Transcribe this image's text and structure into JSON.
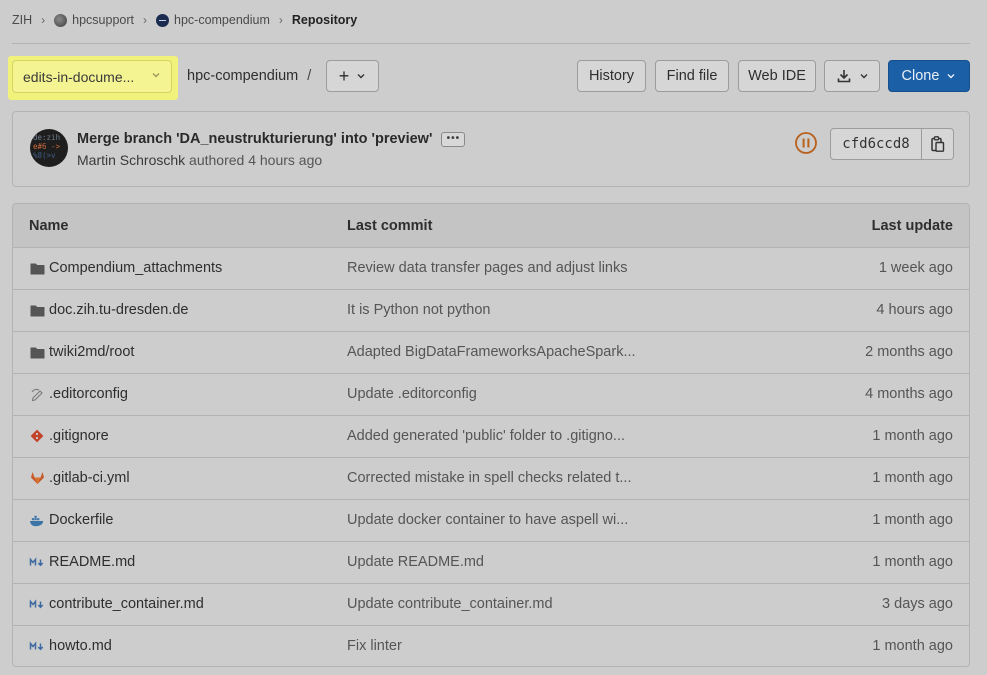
{
  "breadcrumb": {
    "items": [
      {
        "label": "ZIH",
        "icon": ""
      },
      {
        "label": "hpcsupport",
        "icon": "group-avatar-icon"
      },
      {
        "label": "hpc-compendium",
        "icon": "project-avatar-icon"
      },
      {
        "label": "Repository",
        "icon": ""
      }
    ]
  },
  "toolbar": {
    "branch": "edits-in-docume...",
    "repo_name": "hpc-compendium",
    "path_separator": "/",
    "add_label": "+",
    "history_label": "History",
    "find_file_label": "Find file",
    "web_ide_label": "Web IDE",
    "clone_label": "Clone"
  },
  "commit": {
    "title": "Merge branch 'DA_neustrukturierung' into 'preview'",
    "author": "Martin Schroschk",
    "action": "authored",
    "time": "4 hours ago",
    "sha": "cfd6ccd8",
    "avatar_text": [
      "de:zih",
      "e#6 ->",
      "%8(>v"
    ]
  },
  "table": {
    "headers": {
      "name": "Name",
      "last_commit": "Last commit",
      "last_update": "Last update"
    },
    "rows": [
      {
        "name": "Compendium_attachments",
        "icon": "folder-icon",
        "commit": "Review data transfer pages and adjust links",
        "date": "1 week ago"
      },
      {
        "name": "doc.zih.tu-dresden.de",
        "icon": "folder-icon",
        "commit": "It is Python not python",
        "date": "4 hours ago"
      },
      {
        "name": "twiki2md/root",
        "icon": "folder-icon",
        "commit": "Adapted BigDataFrameworksApacheSpark...",
        "date": "2 months ago"
      },
      {
        "name": ".editorconfig",
        "icon": "editorconfig-icon",
        "commit": "Update .editorconfig",
        "date": "4 months ago"
      },
      {
        "name": ".gitignore",
        "icon": "git-icon",
        "commit": "Added generated 'public' folder to .gitigno...",
        "date": "1 month ago"
      },
      {
        "name": ".gitlab-ci.yml",
        "icon": "gitlab-icon",
        "commit": "Corrected mistake in spell checks related t...",
        "date": "1 month ago"
      },
      {
        "name": "Dockerfile",
        "icon": "docker-icon",
        "commit": "Update docker container to have aspell wi...",
        "date": "1 month ago"
      },
      {
        "name": "README.md",
        "icon": "markdown-icon",
        "commit": "Update README.md",
        "date": "1 month ago"
      },
      {
        "name": "contribute_container.md",
        "icon": "markdown-icon",
        "commit": "Update contribute_container.md",
        "date": "3 days ago"
      },
      {
        "name": "howto.md",
        "icon": "markdown-icon",
        "commit": "Fix linter",
        "date": "1 month ago"
      }
    ]
  },
  "colors": {
    "background": "#cdcdcd",
    "highlight": "#f0f27c",
    "clone_button": "#1b5fa6",
    "pipeline_status": "#b8611d"
  }
}
